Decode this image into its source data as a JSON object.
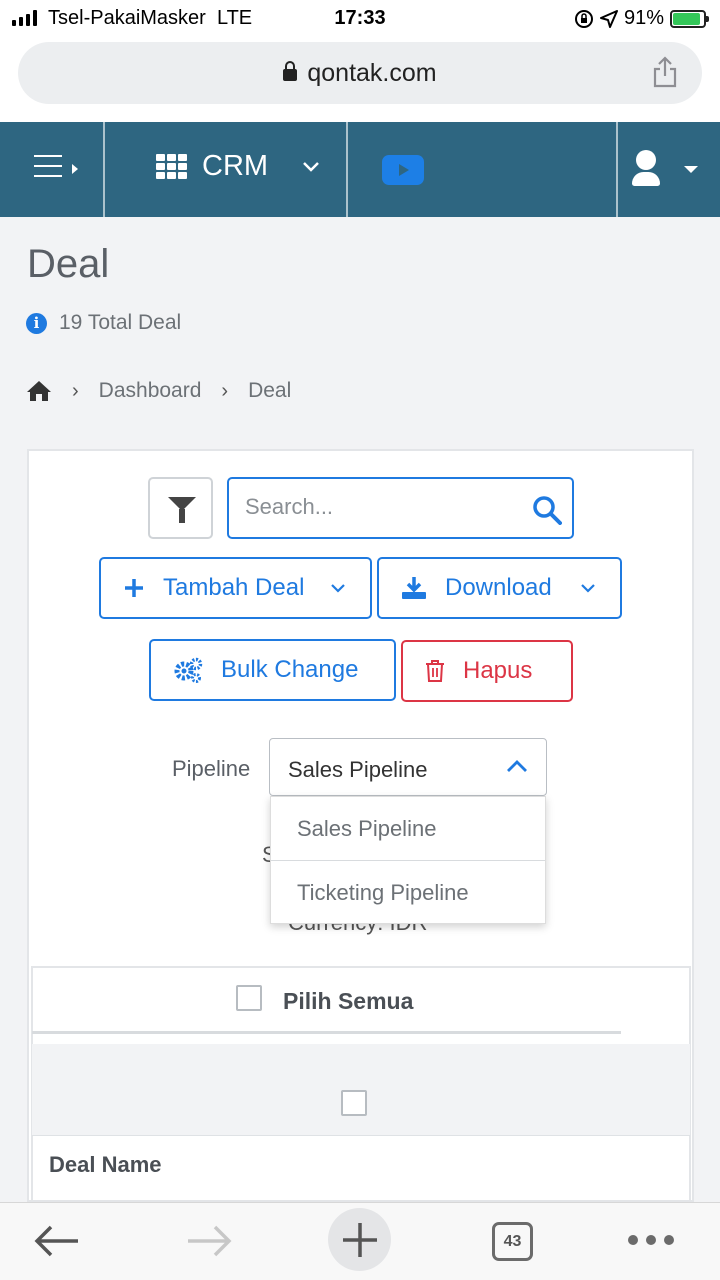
{
  "status_bar": {
    "carrier": "Tsel-PakaiMasker",
    "network": "LTE",
    "time": "17:33",
    "battery": "91%"
  },
  "browser": {
    "url": "qontak.com",
    "tab_count": "43"
  },
  "nav": {
    "module": "CRM"
  },
  "page": {
    "title": "Deal",
    "total": "19 Total Deal",
    "breadcrumb": [
      "Dashboard",
      "Deal"
    ]
  },
  "toolbar": {
    "search_placeholder": "Search...",
    "add_label": "Tambah Deal",
    "download_label": "Download",
    "bulk_label": "Bulk Change",
    "delete_label": "Hapus"
  },
  "pipeline": {
    "label": "Pipeline",
    "selected": "Sales Pipeline",
    "options": [
      "Sales Pipeline",
      "Ticketing Pipeline"
    ],
    "hidden_partial_1": "S",
    "hidden_partial_2": "Currency: IDR"
  },
  "table": {
    "select_all": "Pilih Semua",
    "column_deal_name": "Deal Name"
  },
  "colors": {
    "nav_bg": "#2e6681",
    "primary": "#1f7ae0",
    "danger": "#dc3545"
  },
  "icons": [
    "hamburger-icon",
    "grid-icon",
    "chevron-down-icon",
    "video-icon",
    "user-icon",
    "info-icon",
    "home-icon",
    "filter-icon",
    "search-icon",
    "plus-icon",
    "download-icon",
    "gears-icon",
    "trash-icon",
    "chevron-up-icon",
    "back-icon",
    "forward-icon",
    "new-tab-icon",
    "tabs-icon",
    "more-icon"
  ]
}
